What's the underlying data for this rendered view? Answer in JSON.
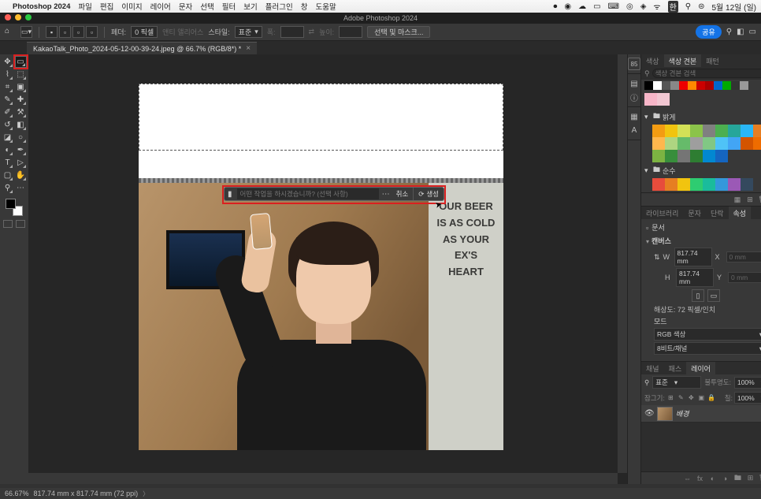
{
  "menubar": {
    "app": "Photoshop 2024",
    "items": [
      "파일",
      "편집",
      "이미지",
      "레이어",
      "문자",
      "선택",
      "필터",
      "보기",
      "플러그인",
      "창",
      "도움말"
    ],
    "clock": "5월 12일 (일)"
  },
  "titlebar": {
    "title": "Adobe Photoshop 2024"
  },
  "options": {
    "feather_label": "페더:",
    "feather_value": "0 픽셀",
    "antialias": "앤티 앨리어스",
    "style_label": "스타일:",
    "style_value": "표준",
    "w_label": "폭:",
    "h_label": "높이:",
    "mask_btn": "선택 및 마스크...",
    "share": "공유"
  },
  "doc": {
    "tab": "KakaoTalk_Photo_2024-05-12-00-39-24.jpeg @ 66.7% (RGB/8*) *"
  },
  "taskbar": {
    "placeholder": "어떤 작업을 하시겠습니까? (선택 사항)",
    "cancel": "취소",
    "generate": "생성"
  },
  "board_lines": [
    "OUR BEER",
    "IS AS COLD",
    "AS YOUR",
    "EX'S",
    "HEART"
  ],
  "swatches_panel": {
    "tabs": [
      "색상",
      "색상 견본",
      "패턴"
    ],
    "search_ph": "색상 견본 검색",
    "groups": {
      "bright": "밝게",
      "pure": "순수"
    }
  },
  "right_tabs2": [
    "라이브러리",
    "문자",
    "단락",
    "속성"
  ],
  "properties": {
    "doc": "문서",
    "canvas": "캔버스",
    "w": "817.74 mm",
    "h": "817.74 mm",
    "res": "해상도: 72 픽셀/인치",
    "mode_label": "모드",
    "mode": "RGB 색상",
    "depth": "8비트/채널"
  },
  "layers": {
    "tabs": [
      "채널",
      "패스",
      "레이어"
    ],
    "kind": "표준",
    "opacity_label": "불투명도:",
    "opacity": "100%",
    "lock_label": "잠그기:",
    "fill_label": "칠:",
    "fill": "100%",
    "bg": "배경"
  },
  "status": {
    "zoom": "66.67%",
    "dims": "817.74 mm x 817.74 mm (72 ppi)"
  }
}
